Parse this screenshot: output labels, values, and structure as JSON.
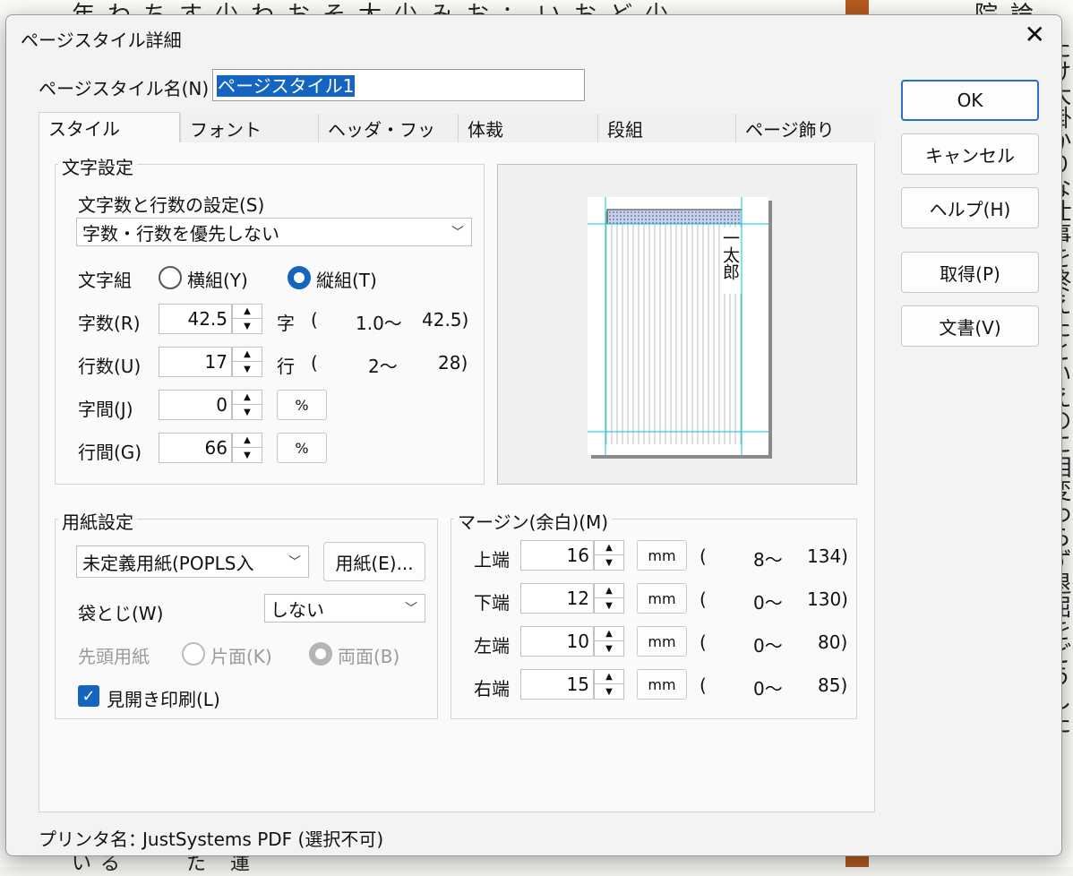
{
  "background": {
    "top_text": "年わちす少わおそ太少みお：いおど少",
    "top_right_text": "院論",
    "right_column_text": "たけ大掛かりな仕事を終えたといえのに相変わらず退屈をどうした",
    "bottom_text": "いる　　た 運"
  },
  "dialog": {
    "title": "ページスタイル詳細",
    "name_label": "ページスタイル名(N)",
    "name_value": "ページスタイル1",
    "buttons": {
      "ok": "OK",
      "cancel": "キャンセル",
      "help": "ヘルプ(H)",
      "get": "取得(P)",
      "document": "文書(V)"
    },
    "tabs": [
      "スタイル",
      "フォント",
      "ヘッダ・フッタ",
      "体裁",
      "段組",
      "ページ飾り"
    ],
    "char_settings": {
      "title": "文字設定",
      "count_label": "文字数と行数の設定(S)",
      "count_value": "字数・行数を優先しない",
      "direction_label": "文字組",
      "horizontal": "横組(Y)",
      "vertical": "縦組(T)",
      "rows": [
        {
          "label": "字数(R)",
          "value": "42.5",
          "unit": "字",
          "range_open": "(",
          "range_min": "1.0〜",
          "range_max": "42.5)"
        },
        {
          "label": "行数(U)",
          "value": "17",
          "unit": "行",
          "range_open": "(",
          "range_min": "2〜",
          "range_max": "28)"
        },
        {
          "label": "字間(J)",
          "value": "0",
          "unit": "%"
        },
        {
          "label": "行間(G)",
          "value": "66",
          "unit": "%"
        }
      ]
    },
    "preview": {
      "sample_text": "一太郎"
    },
    "paper_settings": {
      "title": "用紙設定",
      "paper_value": "未定義用紙(POPLS入",
      "paper_button": "用紙(E)...",
      "binding_label": "袋とじ(W)",
      "binding_value": "しない",
      "first_page_label": "先頭用紙",
      "one_side": "片面(K)",
      "both_sides": "両面(B)",
      "spread_print": "見開き印刷(L)"
    },
    "margins": {
      "title": "マージン(余白)(M)",
      "rows": [
        {
          "label": "上端",
          "value": "16",
          "unit": "mm",
          "range_open": "(",
          "range_min": "8〜",
          "range_max": "134)"
        },
        {
          "label": "下端",
          "value": "12",
          "unit": "mm",
          "range_open": "(",
          "range_min": "0〜",
          "range_max": "130)"
        },
        {
          "label": "左端",
          "value": "10",
          "unit": "mm",
          "range_open": "(",
          "range_min": "0〜",
          "range_max": "80)"
        },
        {
          "label": "右端",
          "value": "15",
          "unit": "mm",
          "range_open": "(",
          "range_min": "0〜",
          "range_max": "85)"
        }
      ]
    },
    "printer_label": "プリンタ名：",
    "printer_value": "JustSystems PDF (選択不可)"
  },
  "colors": {
    "accent": "#1565c0",
    "guide": "#00c8e0"
  }
}
